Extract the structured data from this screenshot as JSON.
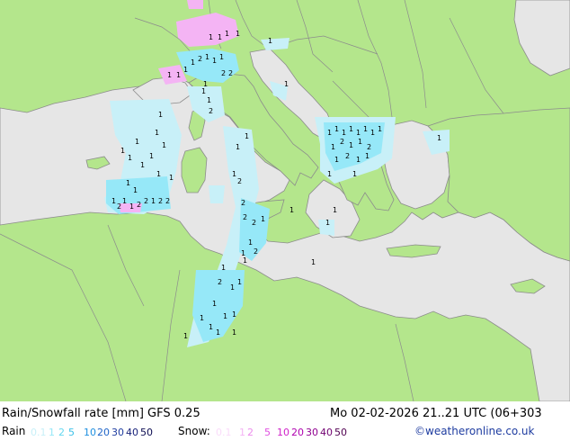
{
  "title": "Rain/Snowfall rate [mm] GFS 0.25",
  "datetime": "Mo 02-02-2026 21..21 UTC (06+303",
  "credit": "©weatheronline.co.uk",
  "legend": {
    "rain_label": "Rain",
    "snow_label": "Snow:",
    "rain_values": [
      {
        "label": "0.1",
        "color": "#c8f0f8"
      },
      {
        "label": "1",
        "color": "#96e8f8"
      },
      {
        "label": "2",
        "color": "#64d8f0"
      },
      {
        "label": "5",
        "color": "#3cc0e8"
      },
      {
        "label": "10",
        "color": "#1e90e0"
      },
      {
        "label": "20",
        "color": "#1e64c8"
      },
      {
        "label": "30",
        "color": "#1e3ca0"
      },
      {
        "label": "40",
        "color": "#141e78"
      },
      {
        "label": "50",
        "color": "#0a0a50"
      }
    ],
    "snow_values": [
      {
        "label": "0.1",
        "color": "#fadcfa"
      },
      {
        "label": "1",
        "color": "#f4b4f4"
      },
      {
        "label": "2",
        "color": "#ec8cec"
      },
      {
        "label": "5",
        "color": "#e050e0"
      },
      {
        "label": "10",
        "color": "#d020c8"
      },
      {
        "label": "20",
        "color": "#b000b0"
      },
      {
        "label": "30",
        "color": "#900090"
      },
      {
        "label": "40",
        "color": "#700070"
      },
      {
        "label": "50",
        "color": "#500050"
      }
    ]
  },
  "colors": {
    "land": "#b4e68c",
    "sea": "#e6e6e6",
    "border": "#8c8c8c",
    "precip_light": "#c8f0f8",
    "precip_medium": "#96e8f8",
    "snow": "#f4b4f4"
  }
}
